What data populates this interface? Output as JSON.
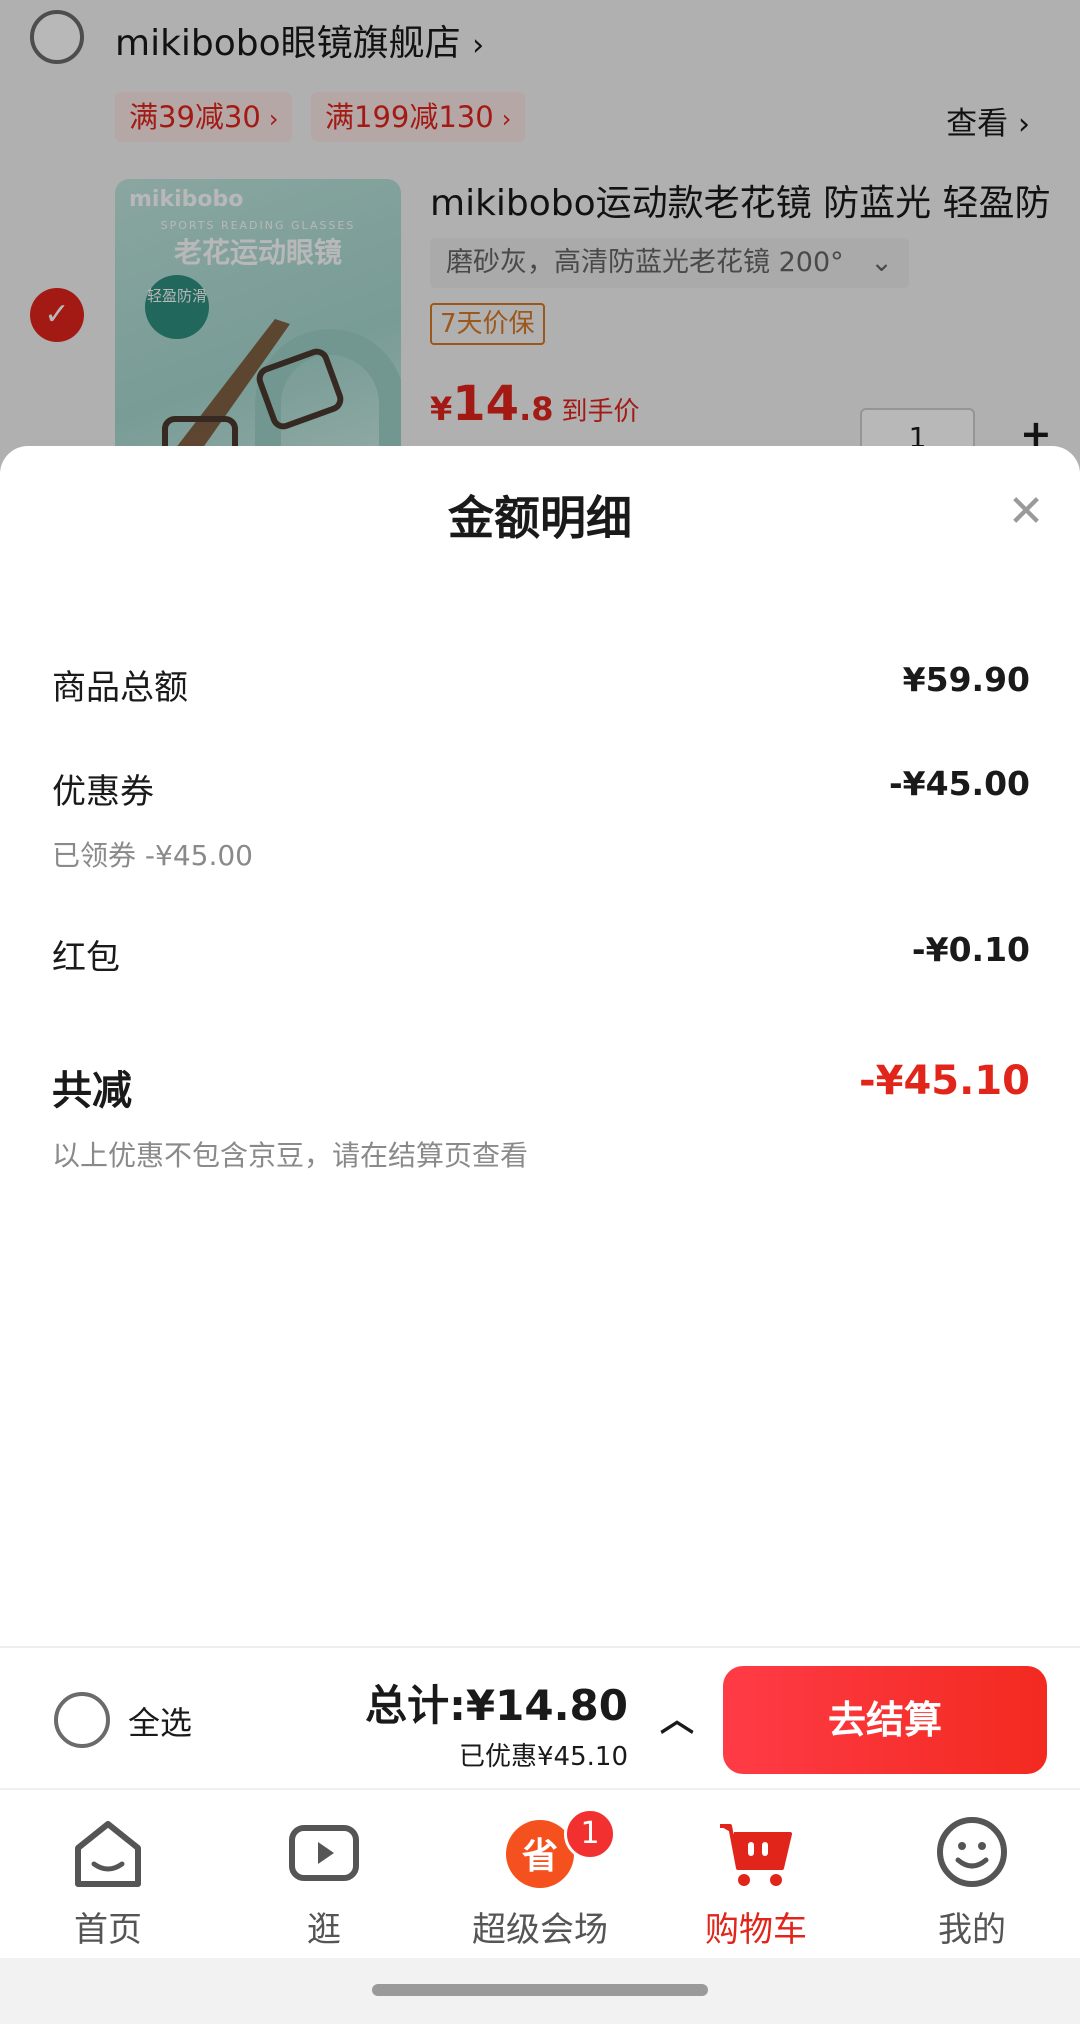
{
  "store": {
    "name": "mikibobo眼镜旗舰店",
    "promos": [
      "满39减30",
      "满199减130"
    ],
    "view_link": "查看"
  },
  "product": {
    "image": {
      "brand": "mikibobo",
      "subtitle": "SPORTS READING GLASSES",
      "name": "老花运动眼镜",
      "badge": "轻盈防滑"
    },
    "title": "mikibobo运动款老花镜 防蓝光 轻盈防",
    "spec": "磨砂灰，高清防蓝光老花镜 200°",
    "tag": "7天价保",
    "price_symbol": "¥",
    "price_int": "14",
    "price_dec": ".8",
    "price_label": "到手价",
    "quantity": "1"
  },
  "sheet": {
    "title": "金额明细",
    "rows": [
      {
        "label": "商品总额",
        "value": "¥59.90"
      },
      {
        "label": "优惠券",
        "value": "-¥45.00",
        "note": "已领券 -¥45.00"
      },
      {
        "label": "红包",
        "value": "-¥0.10"
      }
    ],
    "total_label": "共减",
    "total_value": "-¥45.10",
    "footnote": "以上优惠不包含京豆，请在结算页查看"
  },
  "checkout": {
    "select_all": "全选",
    "total": "总计:¥14.80",
    "saved": "已优惠¥45.10",
    "button": "去结算"
  },
  "tabs": [
    {
      "label": "首页",
      "icon": "home-icon"
    },
    {
      "label": "逛",
      "icon": "video-icon"
    },
    {
      "label": "超级会场",
      "icon": "super-venue-icon",
      "badge": "1"
    },
    {
      "label": "购物车",
      "icon": "cart-icon",
      "active": true
    },
    {
      "label": "我的",
      "icon": "smile-face-icon"
    }
  ],
  "colors": {
    "accent": "#e1251b",
    "checkout_button": "#f22a20",
    "tag_orange": "#d97b28"
  }
}
